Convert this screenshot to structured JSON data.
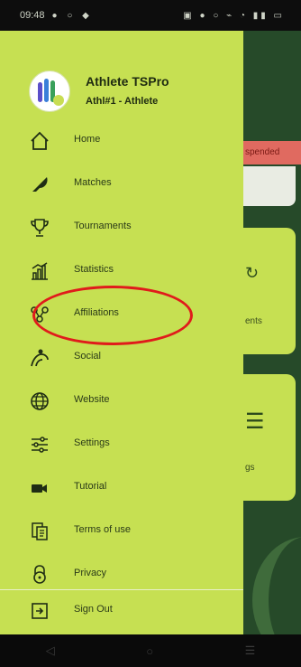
{
  "status_bar": {
    "time": "09:48",
    "left_icons": "● ○ ◆",
    "right_icons": "▣ ● ○ ⌁ ◔ ▮▮ ▭"
  },
  "background_app": {
    "tag": "spended",
    "card1_text": "ents",
    "card2_text": "gs"
  },
  "profile": {
    "name": "Athlete TSPro",
    "role": "Athl#1 - Athlete"
  },
  "menu": {
    "items": [
      {
        "label": "Home",
        "icon": "home-icon"
      },
      {
        "label": "Matches",
        "icon": "shuttlecock-icon"
      },
      {
        "label": "Tournaments",
        "icon": "trophy-icon"
      },
      {
        "label": "Statistics",
        "icon": "statistics-icon"
      },
      {
        "label": "Affiliations",
        "icon": "affiliations-icon"
      },
      {
        "label": "Social",
        "icon": "social-icon"
      },
      {
        "label": "Website",
        "icon": "globe-icon"
      },
      {
        "label": "Settings",
        "icon": "settings-sliders-icon"
      },
      {
        "label": "Tutorial",
        "icon": "video-camera-icon"
      },
      {
        "label": "Terms of use",
        "icon": "document-icon"
      },
      {
        "label": "Privacy",
        "icon": "lock-icon"
      }
    ],
    "sign_out": {
      "label": "Sign Out",
      "icon": "sign-out-icon"
    }
  },
  "nav_bar": {
    "back": "◁",
    "home": "○",
    "recents": "☰"
  },
  "colors": {
    "drawer": "#c6e052",
    "background": "#264a29",
    "highlight": "#e01b1b"
  }
}
